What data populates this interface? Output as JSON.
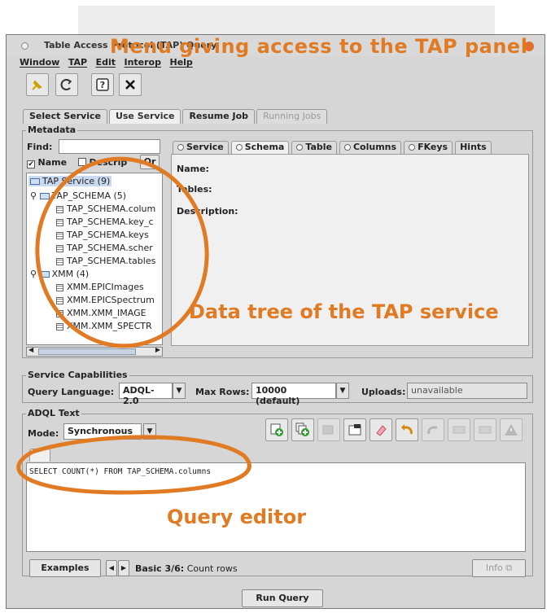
{
  "window": {
    "title": "Table Access Protocol (TAP) Query"
  },
  "menubar": [
    "Window",
    "TAP",
    "Edit",
    "Interop",
    "Help"
  ],
  "tabs": [
    {
      "label": "Select Service",
      "state": "normal"
    },
    {
      "label": "Use Service",
      "state": "active"
    },
    {
      "label": "Resume Job",
      "state": "normal"
    },
    {
      "label": "Running Jobs",
      "state": "disabled"
    }
  ],
  "metadata": {
    "group_label": "Metadata",
    "find_label": "Find:",
    "find_value": "",
    "name_check_label": "Name",
    "descrip_check_label": "Descrip",
    "or_label": "Or",
    "tree": {
      "root": "TAP Service (9)",
      "schema1": "TAP_SCHEMA (5)",
      "schema1_tables": [
        "TAP_SCHEMA.colum",
        "TAP_SCHEMA.key_c",
        "TAP_SCHEMA.keys",
        "TAP_SCHEMA.scher",
        "TAP_SCHEMA.tables"
      ],
      "schema2": "XMM (4)",
      "schema2_tables": [
        "XMM.EPICImages",
        "XMM.EPICSpectrum",
        "XMM.XMM_IMAGE",
        "XMM.XMM_SPECTR"
      ]
    },
    "detail_tabs": [
      "Service",
      "Schema",
      "Table",
      "Columns",
      "FKeys",
      "Hints"
    ],
    "active_detail_tab": "Schema",
    "fields": {
      "name": "Name:",
      "tables": "Tables:",
      "description": "Description:"
    }
  },
  "capabilities": {
    "group_label": "Service Capabilities",
    "query_language_label": "Query Language:",
    "query_language_value": "ADQL-2.0",
    "max_rows_label": "Max Rows:",
    "max_rows_value": "10000 (default)",
    "uploads_label": "Uploads:",
    "uploads_value": "unavailable"
  },
  "adql": {
    "group_label": "ADQL Text",
    "mode_label": "Mode:",
    "mode_value": "Synchronous",
    "query_text": "SELECT COUNT(*) FROM TAP_SCHEMA.columns",
    "examples_label": "Examples",
    "example_status_label": "Basic 3/6:",
    "example_status_value": "Count rows",
    "info_label": "Info"
  },
  "run_query_label": "Run Query",
  "annotations": {
    "menu": "Menu giving access to the TAP panel",
    "tree": "Data tree of the TAP service",
    "editor": "Query editor"
  },
  "colors": {
    "annotation": "#e07b24",
    "panel": "#d6d6d6"
  }
}
